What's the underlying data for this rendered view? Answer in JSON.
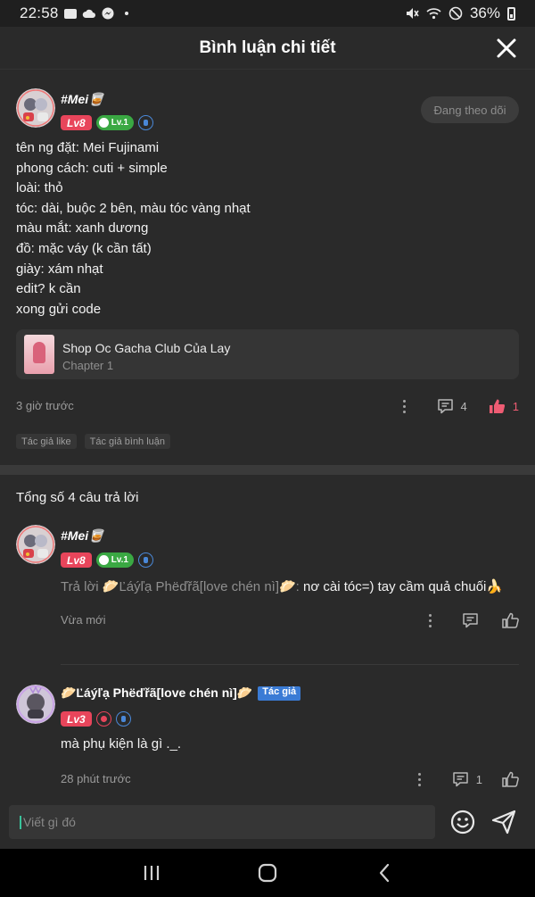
{
  "status_bar": {
    "time": "22:58",
    "battery": "36%"
  },
  "header": {
    "title": "Bình luận chi tiết"
  },
  "main_comment": {
    "username": "#Mei🥃",
    "level": "Lv8",
    "sub_level": "Lv.1",
    "follow_label": "Đang theo dõi",
    "lines": [
      "tên ng đặt: Mei Fujinami",
      "phong cách: cuti + simple",
      "loài: thỏ",
      "tóc: dài, buộc 2 bên, màu tóc vàng nhạt",
      "màu mắt: xanh dương",
      "đồ: mặc váy (k cần tất)",
      "giày: xám nhạt",
      "edit? k cần",
      "xong gửi code"
    ],
    "chapter": {
      "title": "Shop Oc Gacha Club Của Lay",
      "subtitle": "Chapter 1"
    },
    "time": "3 giờ trước",
    "reply_count": "4",
    "like_count": "1",
    "tags": [
      "Tác giả like",
      "Tác giả bình luận"
    ]
  },
  "replies_header": "Tổng số 4 câu trả lời",
  "replies": [
    {
      "username": "#Mei🥃",
      "level": "Lv8",
      "sub_level": "Lv.1",
      "reply_prefix": "Trả lời 🥟Ľáýľạ Phëďřã[love chén nì]🥟:",
      "text": " nơ cài tóc=) tay cầm quả chuối🍌",
      "time": "Vừa mới"
    },
    {
      "username": "🥟Ľáýľạ Phëďřã[love chén nì]🥟",
      "author_tag": "Tác giả",
      "level": "Lv3",
      "text": "mà phụ kiện là gì ._.",
      "time": "28 phút trước",
      "reply_count": "1"
    }
  ],
  "input": {
    "placeholder": "Viết gì đó"
  },
  "colors": {
    "like": "#ef5c73",
    "level_badge": "#e8455b",
    "author_badge": "#3a7bd5",
    "background": "#2a2a2a"
  }
}
